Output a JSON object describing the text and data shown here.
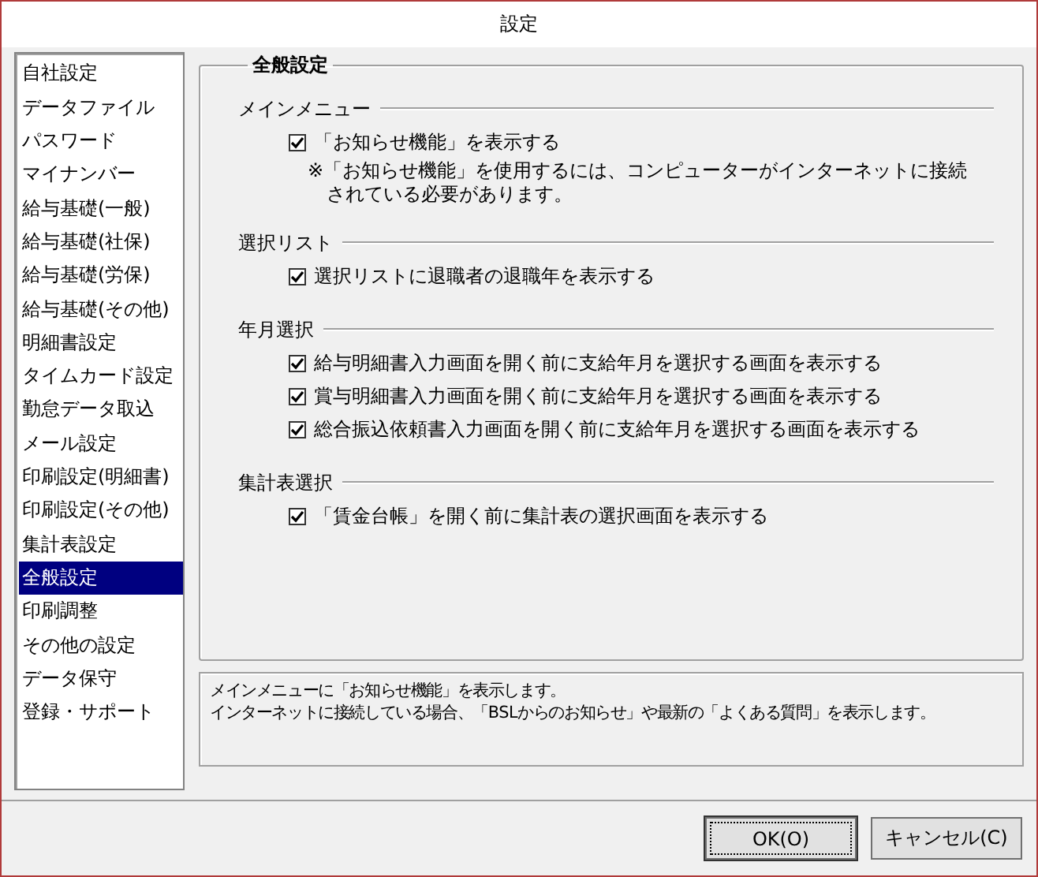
{
  "window": {
    "title": "設定"
  },
  "sidebar": {
    "items": [
      {
        "label": "自社設定",
        "selected": false
      },
      {
        "label": "データファイル",
        "selected": false
      },
      {
        "label": "パスワード",
        "selected": false
      },
      {
        "label": "マイナンバー",
        "selected": false
      },
      {
        "label": "給与基礎(一般)",
        "selected": false
      },
      {
        "label": "給与基礎(社保)",
        "selected": false
      },
      {
        "label": "給与基礎(労保)",
        "selected": false
      },
      {
        "label": "給与基礎(その他)",
        "selected": false
      },
      {
        "label": "明細書設定",
        "selected": false
      },
      {
        "label": "タイムカード設定",
        "selected": false
      },
      {
        "label": "勤怠データ取込",
        "selected": false
      },
      {
        "label": "メール設定",
        "selected": false
      },
      {
        "label": "印刷設定(明細書)",
        "selected": false
      },
      {
        "label": "印刷設定(その他)",
        "selected": false
      },
      {
        "label": "集計表設定",
        "selected": false
      },
      {
        "label": "全般設定",
        "selected": true
      },
      {
        "label": "印刷調整",
        "selected": false
      },
      {
        "label": "その他の設定",
        "selected": false
      },
      {
        "label": "データ保守",
        "selected": false
      },
      {
        "label": "登録・サポート",
        "selected": false
      }
    ]
  },
  "group": {
    "title": "全般設定",
    "sections": [
      {
        "title": "メインメニュー",
        "options": [
          {
            "label": "「お知らせ機能」を表示する",
            "checked": true,
            "note": [
              "※「お知らせ機能」を使用するには、コンピューターがインターネットに接続",
              "されている必要があります。"
            ]
          }
        ]
      },
      {
        "title": "選択リスト",
        "options": [
          {
            "label": "選択リストに退職者の退職年を表示する",
            "checked": true
          }
        ]
      },
      {
        "title": "年月選択",
        "options": [
          {
            "label": "給与明細書入力画面を開く前に支給年月を選択する画面を表示する",
            "checked": true
          },
          {
            "label": "賞与明細書入力画面を開く前に支給年月を選択する画面を表示する",
            "checked": true
          },
          {
            "label": "総合振込依頼書入力画面を開く前に支給年月を選択する画面を表示する",
            "checked": true
          }
        ]
      },
      {
        "title": "集計表選択",
        "options": [
          {
            "label": "「賃金台帳」を開く前に集計表の選択画面を表示する",
            "checked": true
          }
        ]
      }
    ]
  },
  "description": [
    "メインメニューに「お知らせ機能」を表示します。",
    "インターネットに接続している場合、「BSLからのお知らせ」や最新の「よくある質問」を表示します。"
  ],
  "buttons": [
    {
      "label": "OK(O)",
      "default": true
    },
    {
      "label": "キャンセル(C)",
      "default": false
    }
  ]
}
